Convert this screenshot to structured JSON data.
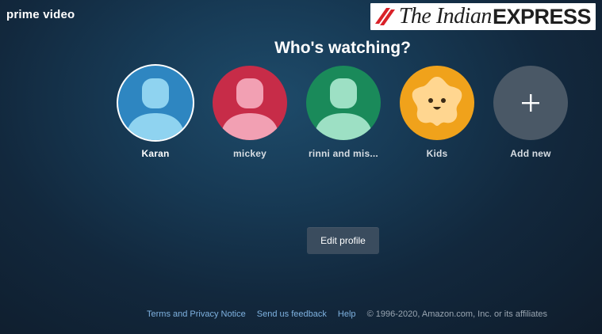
{
  "header": {
    "brand": "prime video",
    "publisher": {
      "the_part": "The Indian",
      "express_part": "EXPRESS"
    }
  },
  "page_title": "Who's watching?",
  "profiles": [
    {
      "name": "Karan",
      "avatar": "person-silhouette",
      "color": "#2e86c1",
      "selected": true
    },
    {
      "name": "mickey",
      "avatar": "person-silhouette",
      "color": "#c72c48",
      "selected": false
    },
    {
      "name": "rinni and mis...",
      "avatar": "person-silhouette",
      "color": "#1a8a5a",
      "selected": false
    },
    {
      "name": "Kids",
      "avatar": "kids-star-face",
      "color": "#f0a21b",
      "selected": false
    },
    {
      "name": "Add new",
      "avatar": "plus-icon",
      "color": "#4a5866",
      "selected": false
    }
  ],
  "edit_profile_label": "Edit profile",
  "footer": {
    "terms": "Terms and Privacy Notice",
    "feedback": "Send us feedback",
    "help": "Help",
    "copyright": "© 1996-2020, Amazon.com, Inc. or its affiliates"
  }
}
